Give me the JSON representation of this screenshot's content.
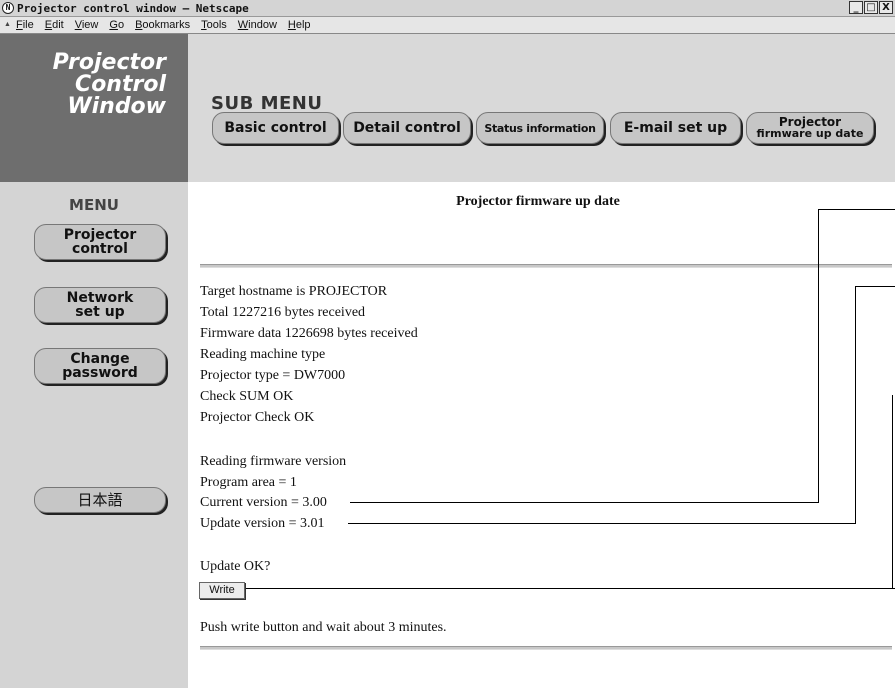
{
  "window": {
    "title": "Projector control window – Netscape",
    "controls": [
      "_",
      "□",
      "X"
    ]
  },
  "menubar": {
    "items": [
      {
        "accel": "F",
        "rest": "ile"
      },
      {
        "accel": "E",
        "rest": "dit"
      },
      {
        "accel": "V",
        "rest": "iew"
      },
      {
        "accel": "G",
        "rest": "o"
      },
      {
        "accel": "B",
        "rest": "ookmarks"
      },
      {
        "accel": "T",
        "rest": "ools"
      },
      {
        "accel": "W",
        "rest": "indow"
      },
      {
        "accel": "H",
        "rest": "elp"
      }
    ]
  },
  "logo": {
    "lines": [
      "Projector",
      "Control",
      "Window"
    ]
  },
  "submenu": {
    "title": "SUB MENU",
    "buttons": {
      "basic": "Basic control",
      "detail": "Detail control",
      "status": "Status information",
      "email": "E-mail set up",
      "firmware_line1": "Projector",
      "firmware_line2": "firmware up date"
    }
  },
  "menu": {
    "title": "MENU",
    "projector_control": [
      "Projector",
      "control"
    ],
    "network_setup": [
      "Network",
      "set up"
    ],
    "change_password": [
      "Change",
      "password"
    ],
    "japanese": "日本語"
  },
  "content": {
    "heading": "Projector firmware up date",
    "log": [
      "Target hostname is PROJECTOR",
      "Total 1227216 bytes received",
      "Firmware data 1226698 bytes received",
      "Reading machine type",
      "Projector type = DW7000",
      "Check SUM OK",
      "Projector Check OK"
    ],
    "version_log": [
      "Reading firmware version",
      "Program area = 1",
      "Current version = 3.00",
      "Update version = 3.01"
    ],
    "update_prompt": "Update OK?",
    "write_button": "Write",
    "instruction": "Push write button and wait about 3 minutes."
  }
}
